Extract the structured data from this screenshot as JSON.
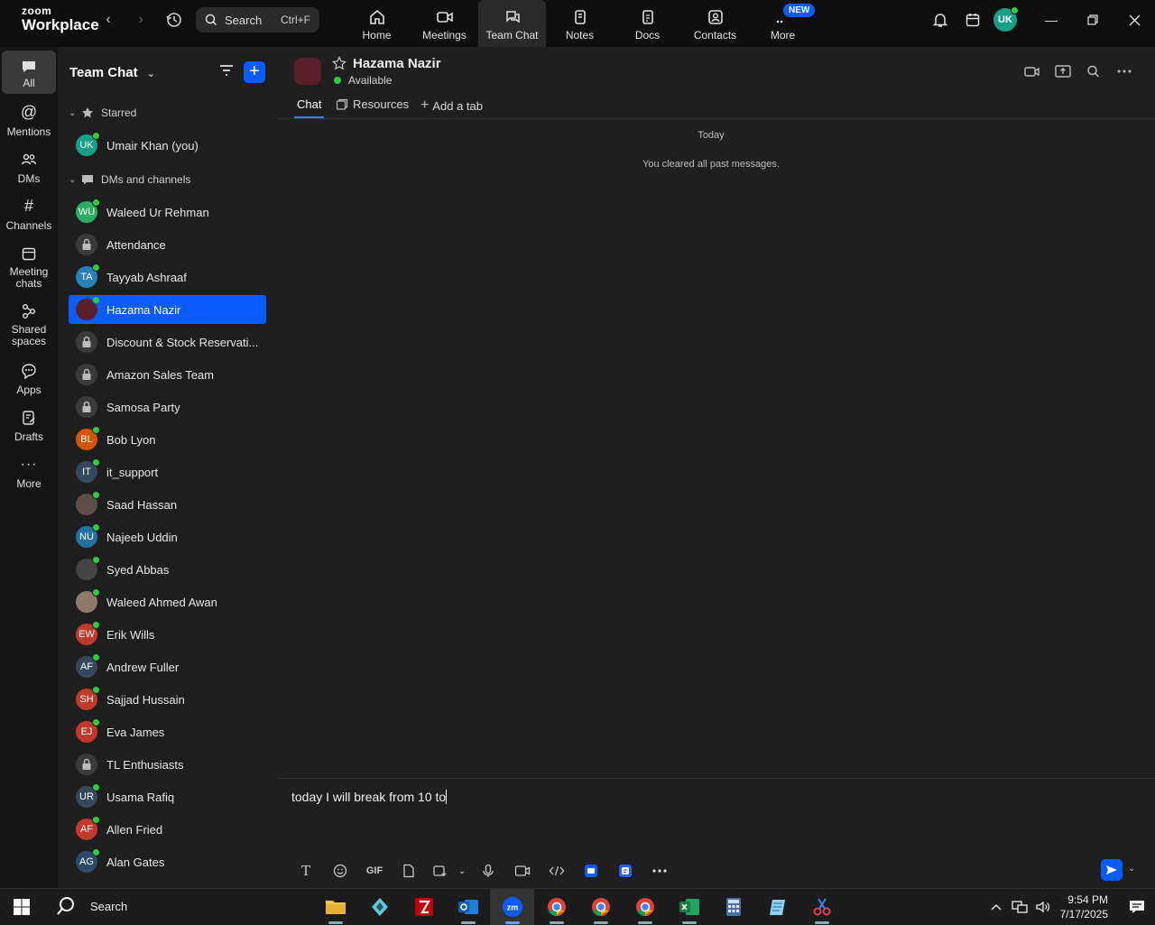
{
  "window": {
    "logo_top": "zoom",
    "logo_bottom": "Workplace"
  },
  "search": {
    "label": "Search",
    "shortcut": "Ctrl+F"
  },
  "topnav": [
    {
      "label": "Home",
      "icon": "home-icon"
    },
    {
      "label": "Meetings",
      "icon": "video-icon"
    },
    {
      "label": "Team Chat",
      "icon": "chat-icon",
      "active": true
    },
    {
      "label": "Notes",
      "icon": "notes-icon"
    },
    {
      "label": "Docs",
      "icon": "docs-icon"
    },
    {
      "label": "Contacts",
      "icon": "contacts-icon"
    },
    {
      "label": "More",
      "icon": "more-icon",
      "badge": "NEW"
    }
  ],
  "user": {
    "initials": "UK"
  },
  "rail": [
    {
      "label": "All",
      "active": true
    },
    {
      "label": "Mentions"
    },
    {
      "label": "DMs"
    },
    {
      "label": "Channels"
    },
    {
      "label": "Meeting chats"
    },
    {
      "label": "Shared spaces"
    },
    {
      "label": "Apps"
    },
    {
      "label": "Drafts"
    },
    {
      "label": "More"
    }
  ],
  "sidebar": {
    "title": "Team Chat",
    "sections": {
      "starred": "Starred",
      "dms": "DMs and channels"
    },
    "starred": [
      {
        "label": "Umair Khan (you)",
        "initials": "UK",
        "color": "#16a085"
      }
    ],
    "items": [
      {
        "label": "Waleed Ur Rehman",
        "initials": "WU",
        "color": "#27ae60",
        "type": "person"
      },
      {
        "label": "Attendance",
        "type": "lock"
      },
      {
        "label": "Tayyab Ashraaf",
        "initials": "TA",
        "color": "#2980b9",
        "type": "person"
      },
      {
        "label": "Hazama Nazir",
        "initials": "",
        "color": "#5a1f2a",
        "type": "person",
        "selected": true
      },
      {
        "label": "Discount & Stock Reservati...",
        "type": "lock"
      },
      {
        "label": "Amazon Sales Team",
        "type": "lock"
      },
      {
        "label": "Samosa Party",
        "type": "lock"
      },
      {
        "label": "Bob Lyon",
        "initials": "BL",
        "color": "#d35400",
        "type": "person"
      },
      {
        "label": "it_support",
        "initials": "IT",
        "color": "#34495e",
        "type": "person"
      },
      {
        "label": "Saad Hassan",
        "initials": "",
        "color": "#5d4e47",
        "type": "person"
      },
      {
        "label": "Najeeb Uddin",
        "initials": "NU",
        "color": "#2471a3",
        "type": "person"
      },
      {
        "label": "Syed Abbas",
        "initials": "",
        "color": "#444444",
        "type": "person"
      },
      {
        "label": "Waleed Ahmed Awan",
        "initials": "",
        "color": "#8e7a6b",
        "type": "person"
      },
      {
        "label": "Erik Wills",
        "initials": "EW",
        "color": "#c0392b",
        "type": "person"
      },
      {
        "label": "Andrew Fuller",
        "initials": "AF",
        "color": "#34495e",
        "type": "person"
      },
      {
        "label": "Sajjad Hussain",
        "initials": "SH",
        "color": "#c0392b",
        "type": "person"
      },
      {
        "label": "Eva James",
        "initials": "EJ",
        "color": "#c0392b",
        "type": "person"
      },
      {
        "label": "TL Enthusiasts",
        "type": "lock"
      },
      {
        "label": "Usama Rafiq",
        "initials": "UR",
        "color": "#34495e",
        "type": "person"
      },
      {
        "label": "Allen Fried",
        "initials": "AF",
        "color": "#c0392b",
        "type": "person"
      },
      {
        "label": "Alan Gates",
        "initials": "AG",
        "color": "#2e4a6b",
        "type": "person"
      }
    ]
  },
  "chat": {
    "name": "Hazama Nazir",
    "status": "Available",
    "tabs": {
      "chat": "Chat",
      "resources": "Resources",
      "add": "Add a tab"
    },
    "date_divider": "Today",
    "system_message": "You cleared all past messages.",
    "composer_text": "today I will break from 10 to",
    "gif_label": "GIF"
  },
  "taskbar": {
    "search": "Search",
    "time": "9:54 PM",
    "date": "7/17/2025"
  },
  "colors": {
    "accent": "#0b5cff",
    "online": "#2ecc40"
  }
}
